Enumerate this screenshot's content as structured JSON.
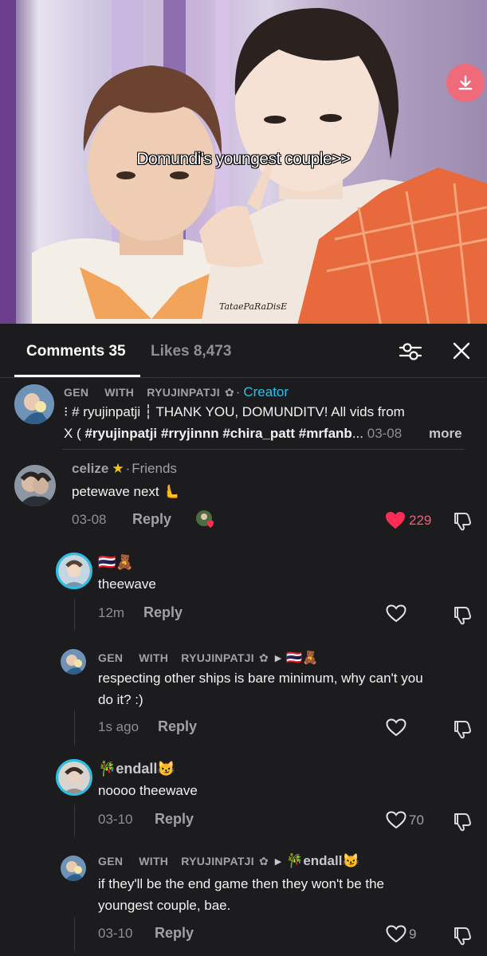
{
  "video": {
    "overlay_text": "Domundi's youngest couple>>",
    "watermark": "TataePaRaDisE",
    "download_icon": "download-icon"
  },
  "tabs": {
    "comments_label": "Comments 35",
    "likes_label": "Likes 8,473"
  },
  "comments": [
    {
      "user1": "GEN",
      "with": "WITH",
      "user2": "RYUJINPATJI",
      "tag": "Creator",
      "line1": "⁝ # ryujinpatji ┆ THANK YOU, DOMUNDITV! All vids from",
      "line2_prefix": "X ( ",
      "line2_hashtags": "#ryujinpatji #rryjinnn #chira_patt #mrfanb",
      "line2_ellipsis": "... ",
      "date": "03-08",
      "more": "more"
    },
    {
      "user": "celize",
      "tag": "Friends",
      "text": "petewave next 🫷",
      "date": "03-08",
      "reply": "Reply",
      "likes": "229"
    },
    {
      "user": "🇹🇭🧸",
      "text": "theewave",
      "date": "12m",
      "reply": "Reply"
    },
    {
      "user1": "GEN",
      "with": "WITH",
      "user2": "RYUJINPATJI",
      "reply_to": "🇹🇭🧸",
      "text_l1": "respecting other ships is bare minimum, why can't you",
      "text_l2": "do it? :)",
      "date": "1s ago",
      "reply": "Reply"
    },
    {
      "user": "🎋endall😼",
      "text": "noooo theewave",
      "date": "03-10",
      "reply": "Reply",
      "likes": "70"
    },
    {
      "user1": "GEN",
      "with": "WITH",
      "user2": "RYUJINPATJI",
      "reply_to": "🎋endall😼",
      "text_l1": "if they'll be the end game then they won't be the",
      "text_l2": "youngest couple, bae.",
      "date": "03-10",
      "reply": "Reply",
      "likes": "9"
    }
  ],
  "colors": {
    "background": "#1c1c1e",
    "accent_creator": "#29c2e6",
    "heart_liked": "#fe2c55",
    "star": "#f5c518"
  }
}
